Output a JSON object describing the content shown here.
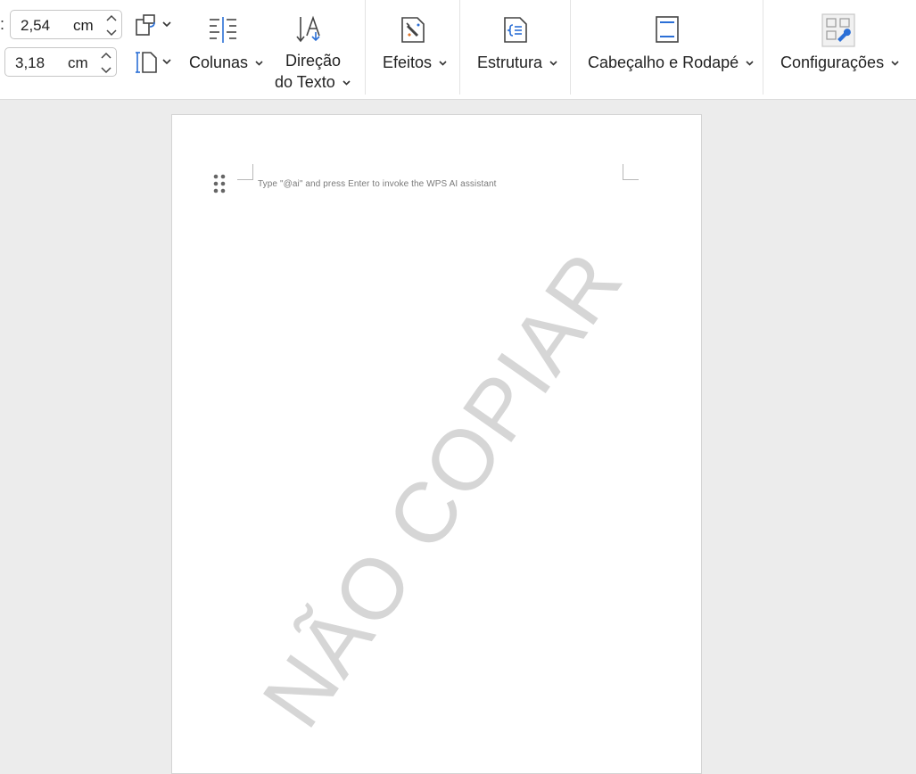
{
  "toolbar": {
    "margins": {
      "label_fragment": ":",
      "top_value": "2,54",
      "left_value": "3,18",
      "unit": "cm"
    },
    "buttons": {
      "columns": "Colunas",
      "text_direction_line1": "Direção",
      "text_direction_line2": "do Texto",
      "effects": "Efeitos",
      "structure": "Estrutura",
      "header_footer": "Cabeçalho e Rodapé",
      "settings": "Configurações"
    }
  },
  "document": {
    "ai_hint": "Type \"@ai\" and press Enter to invoke the WPS AI assistant",
    "watermark": "NÃO COPIAR"
  },
  "colors": {
    "accent": "#2b6fd6",
    "watermark": "#d6d6d6"
  }
}
